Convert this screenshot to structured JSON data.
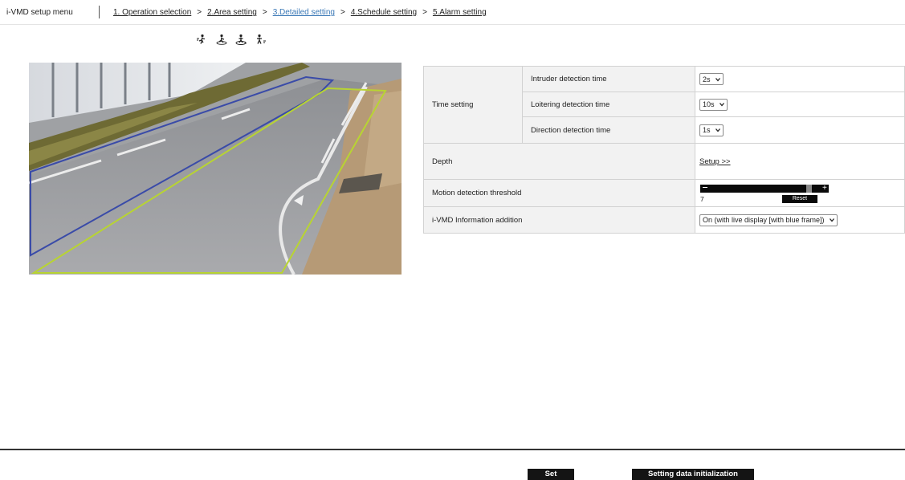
{
  "nav": {
    "title": "i-VMD setup menu",
    "steps": [
      {
        "label": "1. Operation selection",
        "active": false
      },
      {
        "label": "2.Area setting",
        "active": false
      },
      {
        "label": "3.Detailed setting",
        "active": true
      },
      {
        "label": "4.Schedule setting",
        "active": false
      },
      {
        "label": "5.Alarm setting",
        "active": false
      }
    ],
    "separator": ">",
    "mode_icons": [
      "intruder-icon",
      "loitering-icon",
      "direction-icon",
      "motion-icon"
    ]
  },
  "camera": {
    "area_colors": {
      "blue": "#3a4ba8",
      "green": "#b8d432"
    }
  },
  "settings": {
    "time_setting": {
      "label": "Time setting",
      "intruder": {
        "label": "Intruder detection time",
        "value": "2s"
      },
      "loitering": {
        "label": "Loitering detection time",
        "value": "10s"
      },
      "direction": {
        "label": "Direction detection time",
        "value": "1s"
      }
    },
    "depth": {
      "label": "Depth",
      "link": "Setup >>"
    },
    "motion": {
      "label": "Motion detection threshold",
      "value": "7",
      "level": 0.9,
      "reset": "Reset"
    },
    "info": {
      "label": "i-VMD Information addition",
      "value": "On (with live display [with blue frame])"
    }
  },
  "buttons": {
    "set": "Set",
    "init": "Setting data initialization"
  }
}
